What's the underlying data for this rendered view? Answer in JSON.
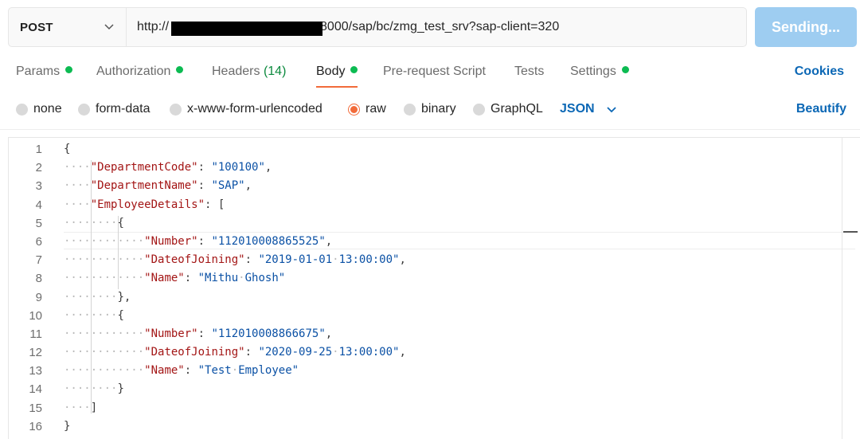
{
  "request": {
    "method": "POST",
    "url_prefix": "http://",
    "url_suffix": "8000/sap/bc/zmg_test_srv?sap-client=320",
    "send_label": "Sending..."
  },
  "tabs": [
    {
      "label": "Params",
      "dot": true
    },
    {
      "label": "Authorization",
      "dot": true
    },
    {
      "label": "Headers",
      "count": "(14)"
    },
    {
      "label": "Body",
      "dot": true,
      "active": true
    },
    {
      "label": "Pre-request Script"
    },
    {
      "label": "Tests"
    },
    {
      "label": "Settings",
      "dot": true
    }
  ],
  "cookies_label": "Cookies",
  "body_options": [
    {
      "label": "none"
    },
    {
      "label": "form-data"
    },
    {
      "label": "x-www-form-urlencoded"
    },
    {
      "label": "raw",
      "selected": true
    },
    {
      "label": "binary"
    },
    {
      "label": "GraphQL"
    }
  ],
  "format_label": "JSON",
  "beautify_label": "Beautify",
  "colors": {
    "accent": "#f26b3a",
    "link": "#0b67b5",
    "status_dot": "#0cbb52",
    "send_button": "#9ecdf1"
  },
  "editor": {
    "lines": [
      {
        "n": "1",
        "indent": 0,
        "tokens": [
          [
            "p",
            "{"
          ]
        ]
      },
      {
        "n": "2",
        "indent": 1,
        "tokens": [
          [
            "k",
            "\"DepartmentCode\""
          ],
          [
            "p",
            ": "
          ],
          [
            "s",
            "\"100100\""
          ],
          [
            "p",
            ","
          ]
        ]
      },
      {
        "n": "3",
        "indent": 1,
        "tokens": [
          [
            "k",
            "\"DepartmentName\""
          ],
          [
            "p",
            ": "
          ],
          [
            "s",
            "\"SAP\""
          ],
          [
            "p",
            ","
          ]
        ]
      },
      {
        "n": "4",
        "indent": 1,
        "tokens": [
          [
            "k",
            "\"EmployeeDetails\""
          ],
          [
            "p",
            ": ["
          ]
        ]
      },
      {
        "n": "5",
        "indent": 2,
        "tokens": [
          [
            "p",
            "{"
          ]
        ]
      },
      {
        "n": "6",
        "indent": 3,
        "tokens": [
          [
            "k",
            "\"Number\""
          ],
          [
            "p",
            ": "
          ],
          [
            "s",
            "\"112010008865525\""
          ],
          [
            "p",
            ","
          ]
        ]
      },
      {
        "n": "7",
        "indent": 3,
        "tokens": [
          [
            "k",
            "\"DateofJoining\""
          ],
          [
            "p",
            ": "
          ],
          [
            "s",
            "\"2019-01-01 13:00:00\""
          ],
          [
            "p",
            ","
          ]
        ]
      },
      {
        "n": "8",
        "indent": 3,
        "tokens": [
          [
            "k",
            "\"Name\""
          ],
          [
            "p",
            ": "
          ],
          [
            "s",
            "\"Mithu Ghosh\""
          ]
        ]
      },
      {
        "n": "9",
        "indent": 2,
        "tokens": [
          [
            "p",
            "},"
          ]
        ]
      },
      {
        "n": "10",
        "indent": 2,
        "tokens": [
          [
            "p",
            "{"
          ]
        ]
      },
      {
        "n": "11",
        "indent": 3,
        "tokens": [
          [
            "k",
            "\"Number\""
          ],
          [
            "p",
            ": "
          ],
          [
            "s",
            "\"112010008866675\""
          ],
          [
            "p",
            ","
          ]
        ]
      },
      {
        "n": "12",
        "indent": 3,
        "tokens": [
          [
            "k",
            "\"DateofJoining\""
          ],
          [
            "p",
            ": "
          ],
          [
            "s",
            "\"2020-09-25 13:00:00\""
          ],
          [
            "p",
            ","
          ]
        ]
      },
      {
        "n": "13",
        "indent": 3,
        "tokens": [
          [
            "k",
            "\"Name\""
          ],
          [
            "p",
            ": "
          ],
          [
            "s",
            "\"Test Employee\""
          ]
        ]
      },
      {
        "n": "14",
        "indent": 2,
        "tokens": [
          [
            "p",
            "}"
          ]
        ]
      },
      {
        "n": "15",
        "indent": 1,
        "tokens": [
          [
            "p",
            "]"
          ]
        ]
      },
      {
        "n": "16",
        "indent": 0,
        "tokens": [
          [
            "p",
            "}"
          ]
        ]
      }
    ]
  }
}
